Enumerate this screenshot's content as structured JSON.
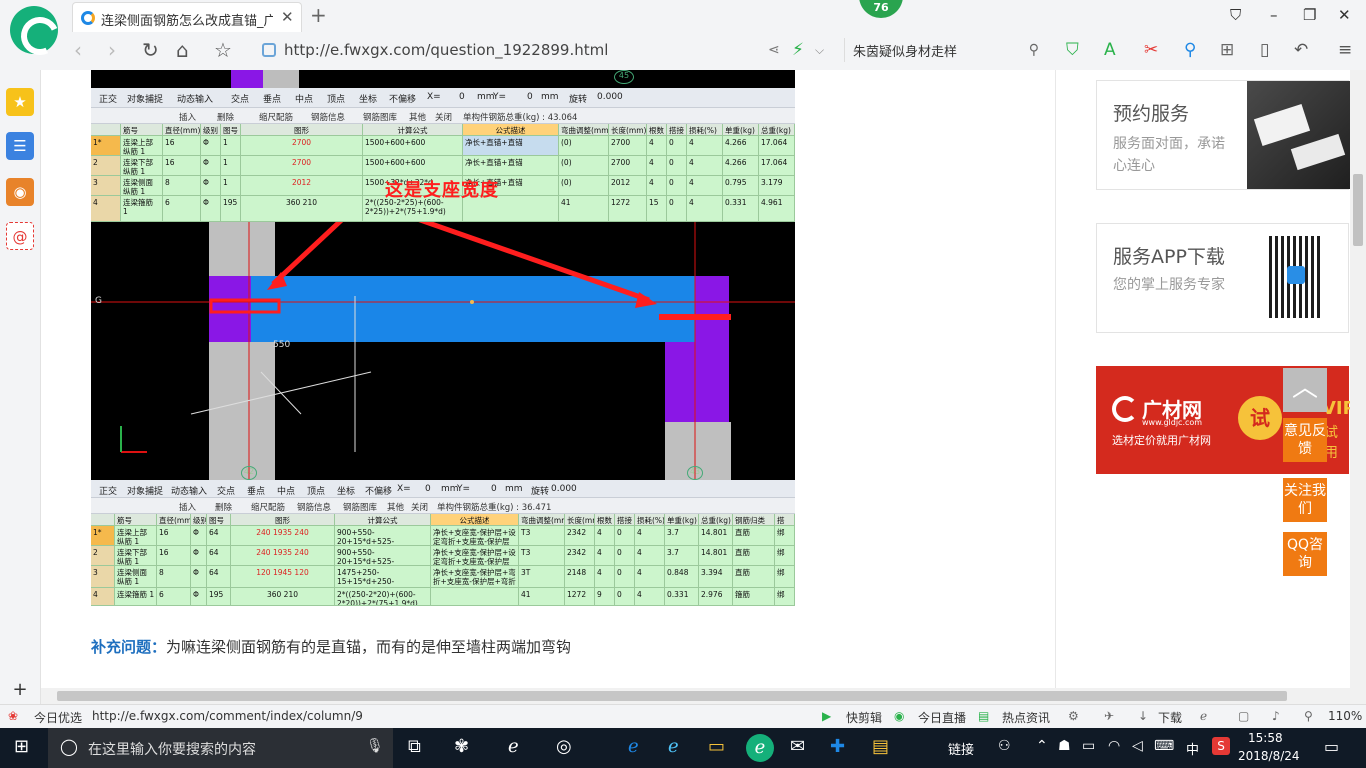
{
  "browser": {
    "tab_title": "连梁侧面钢筋怎么改成直锚_广联",
    "tab_close": "✕",
    "new_tab": "+",
    "badge_number": "76",
    "url": "http://e.fwxgx.com/question_1922899.html",
    "search_text": "朱茵疑似身材走样",
    "window_controls": {
      "skin": "⛉",
      "minimize": "–",
      "restore": "❐",
      "close": "✕"
    }
  },
  "screenshot": {
    "toolbar_top": [
      "正交",
      "对象捕捉",
      "动态输入",
      "交点",
      "垂点",
      "中点",
      "顶点",
      "坐标",
      "不偏移",
      "X=",
      "0",
      "mm",
      "Y=",
      "0",
      "mm",
      "旋转",
      "0.000"
    ],
    "toolbar2": [
      "插入",
      "删除",
      "缩尺配筋",
      "钢筋信息",
      "钢筋图库",
      "其他",
      "关闭",
      "单构件钢筋总重(kg) : 43.064"
    ],
    "table_headers": [
      "筋号",
      "直径(mm)",
      "级别",
      "图号",
      "图形",
      "计算公式",
      "公式描述",
      "弯曲调整(mm)",
      "长度(mm)",
      "根数",
      "搭接",
      "损耗(%)",
      "单重(kg)",
      "总重(kg)"
    ],
    "table_rows": [
      [
        "1*",
        "连梁上部纵筋 1",
        "16",
        "Φ",
        "1",
        "2700",
        "1500+600+600",
        "净长+直锚+直锚",
        "(0)",
        "2700",
        "4",
        "0",
        "4",
        "4.266",
        "17.064"
      ],
      [
        "2",
        "连梁下部纵筋 1",
        "16",
        "Φ",
        "1",
        "2700",
        "1500+600+600",
        "净长+直锚+直锚",
        "(0)",
        "2700",
        "4",
        "0",
        "4",
        "4.266",
        "17.064"
      ],
      [
        "3",
        "连梁侧面纵筋 1",
        "8",
        "Φ",
        "1",
        "2012",
        "1500+32*d+32*d",
        "净长+直锚+直锚",
        "(0)",
        "2012",
        "4",
        "0",
        "4",
        "0.795",
        "3.179"
      ],
      [
        "4",
        "连梁箍筋 1",
        "6",
        "Φ",
        "195",
        "360  210",
        "2*((250-2*25)+(600-2*25))+2*(75+1.9*d)",
        "",
        "41",
        "1272",
        "15",
        "0",
        "4",
        "0.331",
        "4.961"
      ]
    ],
    "annotation": "这是支座宽度",
    "dim_label": "550",
    "axis_labels": [
      "45",
      "G",
      "42",
      "43"
    ],
    "toolbar_bottom": [
      "正交",
      "对象捕捉",
      "动态输入",
      "交点",
      "垂点",
      "中点",
      "顶点",
      "坐标",
      "不偏移",
      "X=",
      "0",
      "mm",
      "Y=",
      "0",
      "mm",
      "旋转",
      "0.000"
    ],
    "toolbar2_bottom": [
      "插入",
      "删除",
      "缩尺配筋",
      "钢筋信息",
      "钢筋图库",
      "其他",
      "关闭",
      "单构件钢筋总重(kg) : 36.471"
    ],
    "table2_headers": [
      "筋号",
      "直径(mm)",
      "级别",
      "图号",
      "图形",
      "计算公式",
      "公式描述",
      "弯曲调整(mm)",
      "长度(mm)",
      "根数",
      "搭接",
      "损耗(%)",
      "单重(kg)",
      "总重(kg)",
      "钢筋归类",
      "搭"
    ],
    "table2_rows": [
      [
        "1*",
        "连梁上部纵筋 1",
        "16",
        "Φ",
        "64",
        "240  1935  240",
        "900+550-20+15*d+525-20+15*d",
        "净长+支座宽-保护层+设定弯折+支座宽-保护层+设定弯折",
        "T3",
        "2342",
        "4",
        "0",
        "4",
        "3.7",
        "14.801",
        "直筋",
        "绑"
      ],
      [
        "2",
        "连梁下部纵筋 1",
        "16",
        "Φ",
        "64",
        "240  1935  240",
        "900+550-20+15*d+525-20+15*d",
        "净长+支座宽-保护层+设定弯折+支座宽-保护层+设定弯折",
        "T3",
        "2342",
        "4",
        "0",
        "4",
        "3.7",
        "14.801",
        "直筋",
        "绑"
      ],
      [
        "3",
        "连梁侧面纵筋 1",
        "8",
        "Φ",
        "64",
        "120  1945  120",
        "1475+250-15+15*d+250-15+15*d",
        "净长+支座宽-保护层+弯折+支座宽-保护层+弯折",
        "3T",
        "2148",
        "4",
        "0",
        "4",
        "0.848",
        "3.394",
        "直筋",
        "绑"
      ],
      [
        "4",
        "连梁箍筋 1",
        "6",
        "Φ",
        "195",
        "360  210",
        "2*((250-2*20)+(600-2*20))+2*(75+1.9*d)",
        "",
        "41",
        "1272",
        "9",
        "0",
        "4",
        "0.331",
        "2.976",
        "箍筋",
        "绑"
      ]
    ]
  },
  "question": {
    "label": "补充问题：",
    "text": "为嘛连梁侧面钢筋有的是直锚，而有的是伸至墙柱两端加弯钩"
  },
  "right": {
    "service_title": "预约服务",
    "service_desc": "服务面对面，承诺心连心",
    "app_title": "服务APP下载",
    "app_desc": "您的掌上服务专家",
    "ad_brand": "广材网",
    "ad_url": "www.gldjc.com",
    "ad_slogan": "选材定价就用广材网",
    "ad_try": "试",
    "ad_vip": "VIP",
    "ad_tail": "试用",
    "float_top": "︿",
    "float_feedback": "意见反馈",
    "float_follow": "关注我们",
    "float_qq": "QQ咨询"
  },
  "statusbar": {
    "left_label": "今日优选",
    "hover_url": "http://e.fwxgx.com/comment/index/column/9",
    "items": [
      "快剪辑",
      "今日直播",
      "热点资讯",
      "下载",
      "110%"
    ]
  },
  "taskbar": {
    "search_placeholder": "在这里输入你要搜索的内容",
    "tray_link": "链接",
    "ime": "中",
    "time": "15:58",
    "date": "2018/8/24"
  },
  "colors": {
    "brand_green": "#15b07a",
    "beam_blue": "#1a86e8",
    "wall_purple": "#8a17e6",
    "arrow_red": "#ff1e1e",
    "float_orange": "#f07a12",
    "ad_red": "#d42a1e",
    "link_blue": "#1e6fbf"
  }
}
